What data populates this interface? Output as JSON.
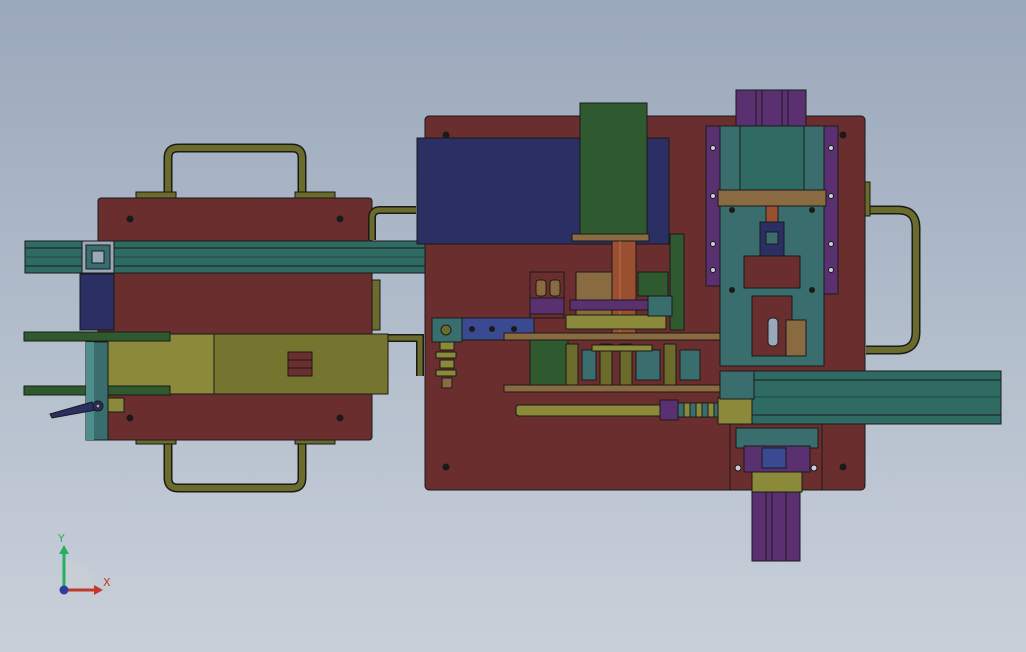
{
  "scene": {
    "background_top": "#9aa8bb",
    "background_bottom": "#c9d0d9",
    "outline": "#1a1a1a",
    "colors": {
      "base_plate": "#6b2e2e",
      "handle": "#6b6b2c",
      "aluminum_profile": "#2f6a63",
      "navy_block": "#2b2f63",
      "dark_green": "#2f5a2f",
      "olive": "#8a8a3a",
      "teal": "#3a6e6e",
      "purple": "#5a3070",
      "wood": "#8a6a40",
      "rod": "#9a5030",
      "blue_bracket": "#3a4a90"
    }
  },
  "triad": {
    "x_label": "X",
    "y_label": "Y",
    "x_color": "#c0392b",
    "y_color": "#27ae60",
    "origin_color": "#2c3e99"
  }
}
